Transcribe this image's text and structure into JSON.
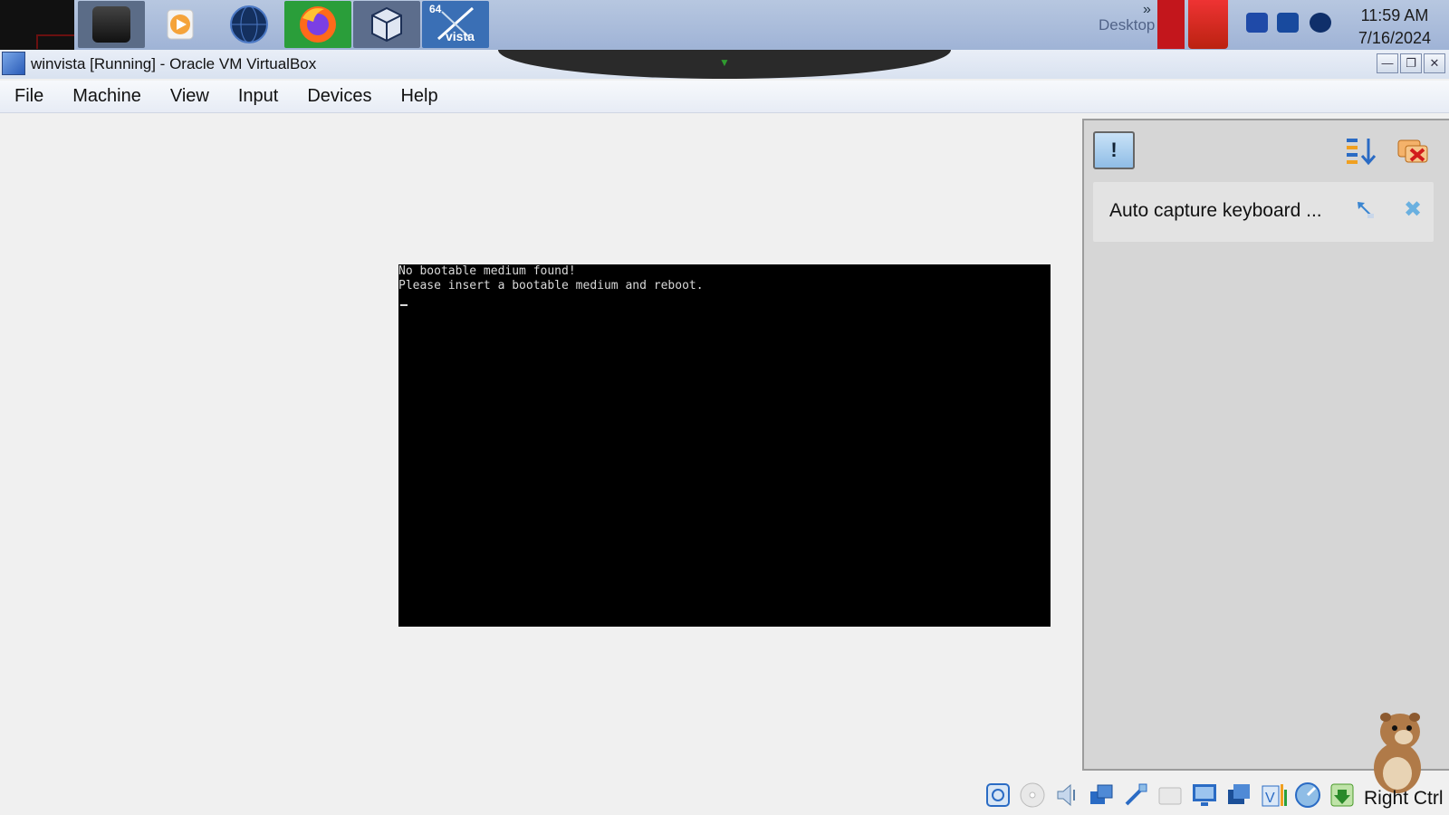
{
  "taskbar": {
    "apps": [
      {
        "name": "app-dark-folder",
        "color": "#2b2b2b"
      },
      {
        "name": "media-player",
        "color": "#f5a33a"
      },
      {
        "name": "globe-browser",
        "color": "#1b3d7a"
      },
      {
        "name": "firefox",
        "color": "#ff7a1a"
      },
      {
        "name": "virtualbox",
        "color": "#6c7fa8"
      },
      {
        "name": "vista-64",
        "color": "#3a6fb5"
      }
    ],
    "vista_badge": "64",
    "vista_label": "vista",
    "tray_desktop_text": "Desktop",
    "clock": {
      "time": "11:59 AM",
      "date": "7/16/2024"
    }
  },
  "window": {
    "title": "winvista [Running] - Oracle VM VirtualBox",
    "buttons": {
      "minimize": "—",
      "restore": "❐",
      "close": "✕"
    }
  },
  "menu": {
    "items": [
      {
        "id": "file",
        "label": "File"
      },
      {
        "id": "machine",
        "label": "Machine"
      },
      {
        "id": "view",
        "label": "View"
      },
      {
        "id": "input",
        "label": "Input"
      },
      {
        "id": "devices",
        "label": "Devices"
      },
      {
        "id": "help",
        "label": "Help"
      }
    ]
  },
  "console": {
    "line1": "No bootable medium found!",
    "line2": "Please insert a bootable medium and reboot."
  },
  "notification_center": {
    "info_glyph": "!",
    "item_text": "Auto capture keyboard ...",
    "close_glyph": "✖"
  },
  "statusbar": {
    "host_key": "Right Ctrl",
    "icons": [
      "hard-disk-icon",
      "optical-drive-icon",
      "audio-icon",
      "network-icon",
      "usb-icon",
      "shared-folders-icon",
      "display-icon",
      "recording-icon",
      "cpu-icon",
      "mouse-integration-icon",
      "download-icon"
    ]
  },
  "colors": {
    "taskbar": "#a9bcdc",
    "console_bg": "#000000",
    "console_fg": "#d8d8d8",
    "panel_bg": "#d6d6d6"
  }
}
